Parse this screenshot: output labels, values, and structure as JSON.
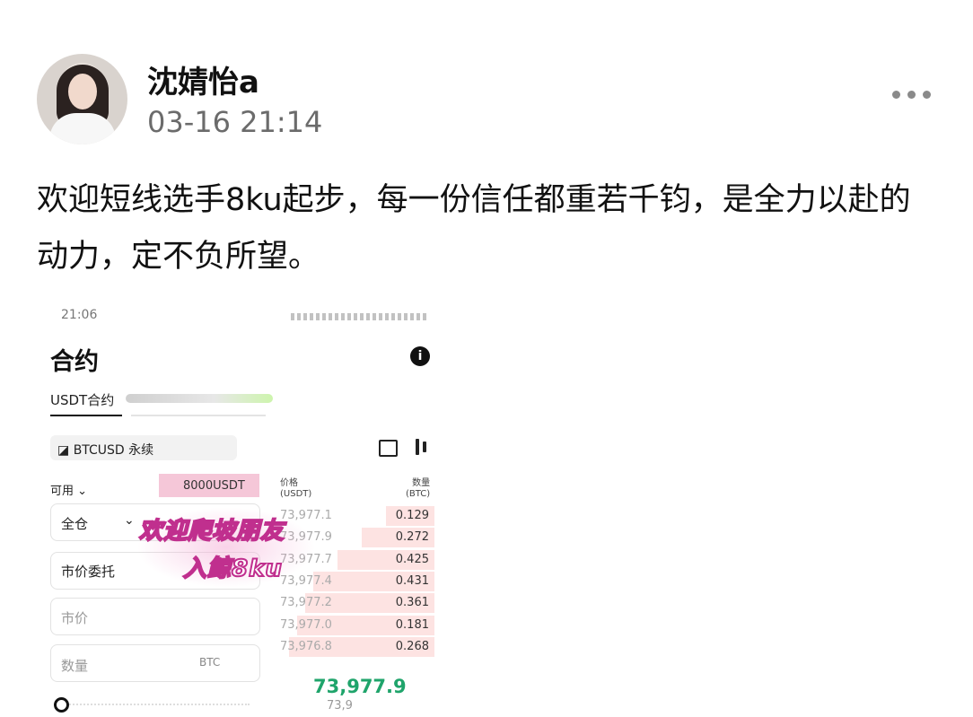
{
  "post": {
    "username": "沈婧怡a",
    "timestamp": "03-16 21:14",
    "text": "欢迎短线选手8ku起步，每一份信任都重若千钧，是全力以赴的动力，定不负所望。"
  },
  "screenshot": {
    "clock": "21:06",
    "title": "合约",
    "tab_label": "USDT合约",
    "symbol": "BTCUSD",
    "symbol_suffix": "永续",
    "available_label": "可用",
    "balance": "8000USDT",
    "margin_mode": "全仓",
    "order_type": "市价委托",
    "price_placeholder": "市价",
    "qty_placeholder": "数量",
    "qty_unit": "BTC",
    "orderbook_price_header": "价格\n(USDT)",
    "orderbook_qty_header": "数量\n(BTC)",
    "orderbook": [
      {
        "price": "73,977.1",
        "qty": "0.129",
        "depth": 0.3
      },
      {
        "price": "73,977.9",
        "qty": "0.272",
        "depth": 0.45
      },
      {
        "price": "73,977.7",
        "qty": "0.425",
        "depth": 0.6
      },
      {
        "price": "73,977.4",
        "qty": "0.431",
        "depth": 0.75
      },
      {
        "price": "73,977.2",
        "qty": "0.361",
        "depth": 0.8
      },
      {
        "price": "73,977.0",
        "qty": "0.181",
        "depth": 0.85
      },
      {
        "price": "73,976.8",
        "qty": "0.268",
        "depth": 0.9
      }
    ],
    "last_price": "73,977.9",
    "mark_price": "73,9",
    "overlay_line1": "欢迎爬坡朋友",
    "overlay_line2": "入鲸8ku"
  }
}
